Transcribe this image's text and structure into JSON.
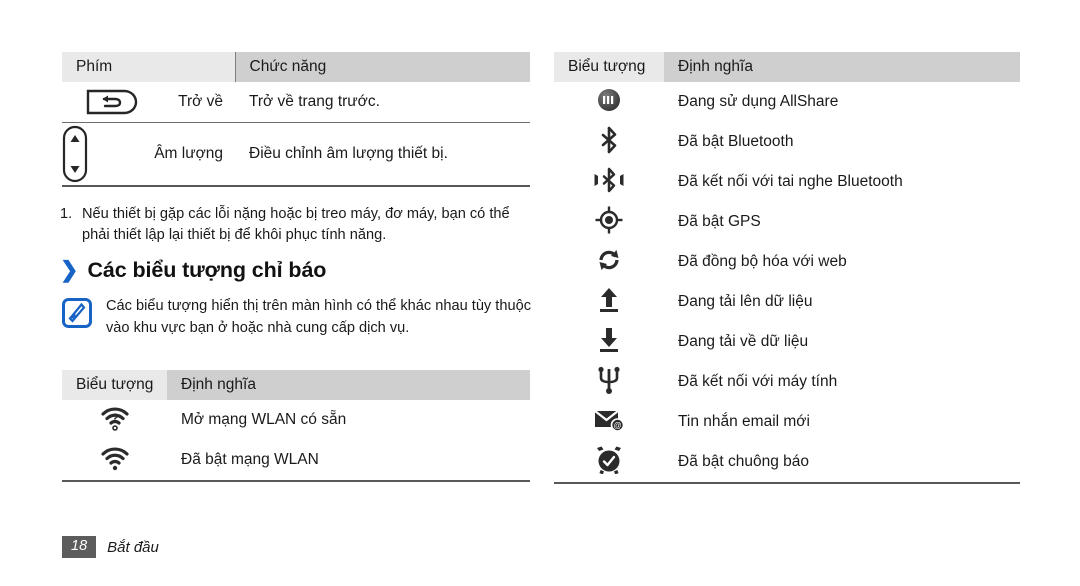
{
  "key_table": {
    "headers": [
      "Phím",
      "Chức năng"
    ],
    "rows": [
      {
        "icon": "back-key-icon",
        "key": "Trở về",
        "function": "Trở về trang trước."
      },
      {
        "icon": "volume-key-icon",
        "key": "Âm lượng",
        "function": "Điều chỉnh âm lượng thiết bị."
      }
    ]
  },
  "note_item": {
    "number": "1.",
    "text": "Nếu thiết bị gặp các lỗi nặng hoặc bị treo máy, đơ máy, bạn có thể phải thiết lập lại thiết bị để khôi phục tính năng."
  },
  "heading": {
    "chevron": "❯",
    "title": "Các biểu tượng chỉ báo",
    "chevron_color": "#1763c6"
  },
  "note_box": {
    "icon": "samsung-note-icon",
    "icon_color": "#1763c6",
    "text": "Các biểu tượng hiển thị trên màn hình có thể khác nhau tùy thuộc vào khu vực bạn ở hoặc nhà cung cấp dịch vụ."
  },
  "left_icon_table": {
    "headers": [
      "Biểu tượng",
      "Định nghĩa"
    ],
    "rows": [
      {
        "icon": "wifi-open-network-icon",
        "definition": "Mở mạng WLAN có sẵn"
      },
      {
        "icon": "wifi-connected-icon",
        "definition": "Đã bật mạng WLAN"
      }
    ]
  },
  "right_icon_table": {
    "headers": [
      "Biểu tượng",
      "Định nghĩa"
    ],
    "rows": [
      {
        "icon": "allshare-icon",
        "definition": "Đang sử dụng AllShare"
      },
      {
        "icon": "bluetooth-icon",
        "definition": "Đã bật Bluetooth"
      },
      {
        "icon": "bluetooth-headset-icon",
        "definition": "Đã kết nối với tai nghe Bluetooth"
      },
      {
        "icon": "gps-icon",
        "definition": "Đã bật GPS"
      },
      {
        "icon": "web-sync-icon",
        "definition": "Đã đồng bộ hóa với web"
      },
      {
        "icon": "upload-icon",
        "definition": "Đang tải lên dữ liệu"
      },
      {
        "icon": "download-icon",
        "definition": "Đang tải về dữ liệu"
      },
      {
        "icon": "usb-icon",
        "definition": "Đã kết nối với máy tính"
      },
      {
        "icon": "new-email-icon",
        "definition": "Tin nhắn email mới"
      },
      {
        "icon": "alarm-icon",
        "definition": "Đã bật chuông báo"
      }
    ]
  },
  "footer": {
    "page_number": "18",
    "section_label": "Bắt đầu",
    "page_badge_color": "#5c5c5c"
  },
  "colors": {
    "header_icon_bg": "#e9e9e9",
    "header_def_bg": "#cfcfcf",
    "rule": "#585858",
    "accent_blue": "#1763c6"
  }
}
